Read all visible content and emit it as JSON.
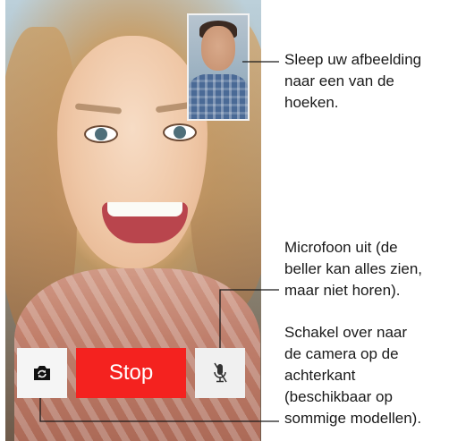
{
  "call": {
    "stop_label": "Stop"
  },
  "icons": {
    "flip_camera": "camera-flip-icon",
    "mute": "microphone-muted-icon"
  },
  "colors": {
    "stop_button": "#f4221f",
    "control_button": "#f5f5f5",
    "callout_line": "#1a1a1a"
  },
  "annotations": {
    "drag_pip": [
      "Sleep uw afbeelding",
      "naar een van de",
      "hoeken."
    ],
    "mute": [
      "Microfoon uit (de",
      "beller kan alles zien,",
      "maar niet horen)."
    ],
    "flip_camera": [
      "Schakel over naar",
      "de camera op de",
      "achterkant",
      "(beschikbaar op",
      "sommige modellen)."
    ]
  }
}
